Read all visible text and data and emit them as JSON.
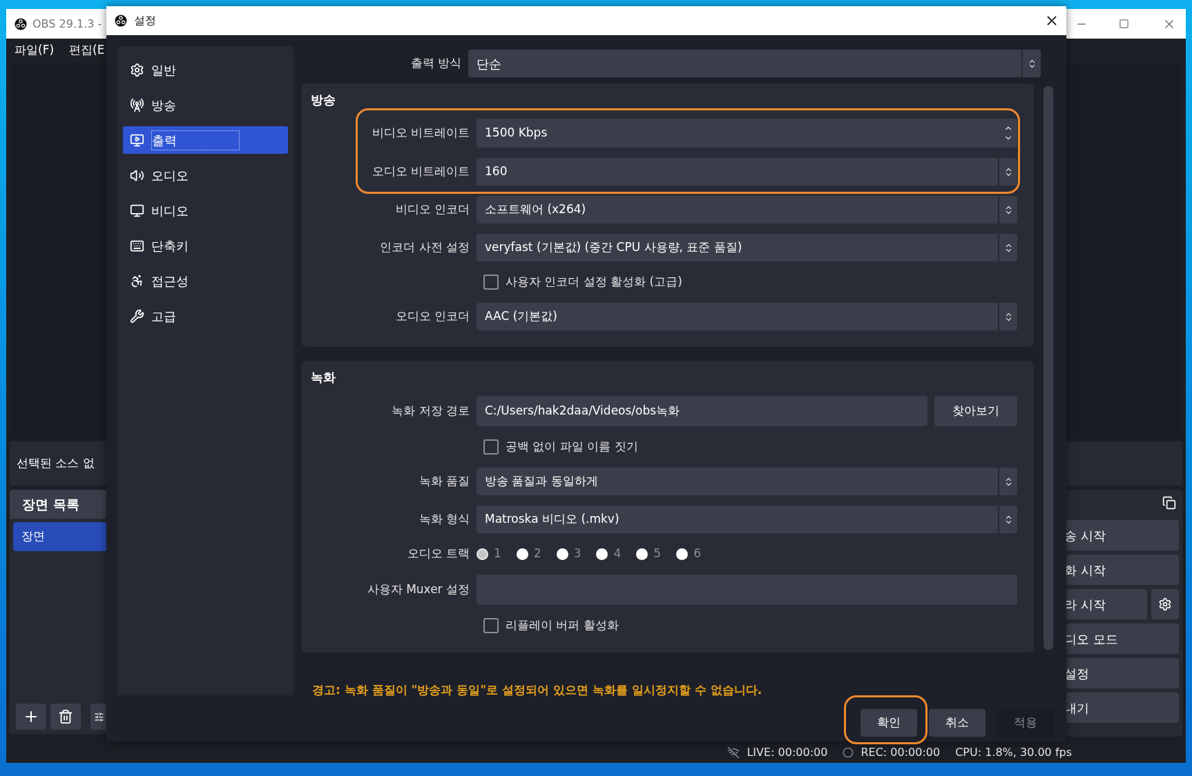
{
  "main_window": {
    "title": "OBS 29.1.3 -",
    "menu": [
      "파일(F)",
      "편집(E"
    ],
    "source_info": "선택된 소스 없",
    "scenes": {
      "title": "장면 목록",
      "items": [
        {
          "label": "장면",
          "selected": true
        }
      ]
    },
    "controls": [
      {
        "label": "송 시작",
        "has_settings": false
      },
      {
        "label": "화 시작",
        "has_settings": false
      },
      {
        "label": "라 시작",
        "has_settings": true
      },
      {
        "label": "디오 모드",
        "has_settings": false
      },
      {
        "label": "설정",
        "has_settings": false
      },
      {
        "label": "내기",
        "has_settings": false
      }
    ],
    "status_bar": [
      {
        "kind": "live",
        "text": "LIVE: 00:00:00"
      },
      {
        "kind": "rec",
        "text": "REC: 00:00:00"
      },
      {
        "kind": "cpu",
        "text": "CPU: 1.8%, 30.00 fps"
      }
    ]
  },
  "settings_dialog": {
    "title": "설정",
    "sidebar": [
      {
        "label": "일반",
        "selected": false
      },
      {
        "label": "방송",
        "selected": false
      },
      {
        "label": "출력",
        "selected": true
      },
      {
        "label": "오디오",
        "selected": false
      },
      {
        "label": "비디오",
        "selected": false
      },
      {
        "label": "단축키",
        "selected": false
      },
      {
        "label": "접근성",
        "selected": false
      },
      {
        "label": "고급",
        "selected": false
      }
    ],
    "output_mode": {
      "label": "출력 방식",
      "value": "단순"
    },
    "sections": [
      {
        "title": "방송",
        "rows": [
          {
            "kind": "spin",
            "label": "비디오 비트레이트",
            "value": "1500 Kbps",
            "highlighted": true
          },
          {
            "kind": "combo",
            "label": "오디오 비트레이트",
            "value": "160",
            "highlighted": true
          },
          {
            "kind": "combo",
            "label": "비디오 인코더",
            "value": "소프트웨어 (x264)",
            "highlighted": false
          },
          {
            "kind": "combo",
            "label": "인코더 사전 설정",
            "value": "veryfast (기본값) (중간 CPU 사용량, 표준 품질)",
            "highlighted": false
          },
          {
            "kind": "checkbox",
            "label": "사용자 인코더 설정 활성화 (고급)",
            "checked": false,
            "highlighted": false
          },
          {
            "kind": "combo",
            "label": "오디오 인코더",
            "value": "AAC (기본값)",
            "highlighted": false
          }
        ]
      },
      {
        "title": "녹화",
        "rows": [
          {
            "kind": "path",
            "label": "녹화 저장 경로",
            "value": "C:/Users/hak2daa/Videos/obs녹화",
            "button": "찾아보기",
            "highlighted": false
          },
          {
            "kind": "checkbox",
            "label": "공백 없이 파일 이름 짓기",
            "checked": false,
            "highlighted": false
          },
          {
            "kind": "combo",
            "label": "녹화 품질",
            "value": "방송 품질과 동일하게",
            "highlighted": false
          },
          {
            "kind": "combo",
            "label": "녹화 형식",
            "value": "Matroska 비디오 (.mkv)",
            "highlighted": false
          },
          {
            "kind": "radio",
            "label": "오디오 트랙",
            "highlighted": false,
            "options": [
              {
                "label": "1",
                "selected": true
              },
              {
                "label": "2",
                "selected": false
              },
              {
                "label": "3",
                "selected": false
              },
              {
                "label": "4",
                "selected": false
              },
              {
                "label": "5",
                "selected": false
              },
              {
                "label": "6",
                "selected": false
              }
            ]
          },
          {
            "kind": "input",
            "label": "사용자 Muxer 설정",
            "highlighted": false
          },
          {
            "kind": "checkbox",
            "label": "리플레이 버퍼 활성화",
            "checked": false,
            "highlighted": false
          }
        ]
      }
    ],
    "warning": "경고: 녹화 품질이 \"방송과 동일\"로 설정되어 있으면 녹화를 일시정지할 수 없습니다.",
    "buttons": [
      {
        "label": "확인",
        "disabled": false,
        "highlighted": true
      },
      {
        "label": "취소",
        "disabled": false,
        "highlighted": false
      },
      {
        "label": "적용",
        "disabled": true,
        "highlighted": false
      }
    ]
  }
}
